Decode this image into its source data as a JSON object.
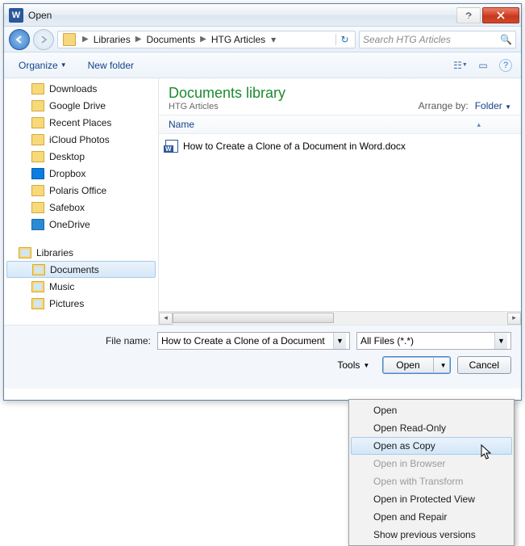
{
  "window": {
    "title": "Open"
  },
  "breadcrumb": {
    "items": [
      "Libraries",
      "Documents",
      "HTG Articles"
    ]
  },
  "search": {
    "placeholder": "Search HTG Articles"
  },
  "toolbar": {
    "organize": "Organize",
    "newfolder": "New folder"
  },
  "tree": {
    "items": [
      "Downloads",
      "Google Drive",
      "Recent Places",
      "iCloud Photos",
      "Desktop",
      "Dropbox",
      "Polaris Office",
      "Safebox",
      "OneDrive"
    ],
    "libs_label": "Libraries",
    "libs": [
      "Documents",
      "Music",
      "Pictures"
    ]
  },
  "library": {
    "title": "Documents library",
    "subtitle": "HTG Articles",
    "arrange_label": "Arrange by:",
    "arrange_value": "Folder"
  },
  "columns": {
    "name": "Name"
  },
  "files": [
    {
      "name": "How to Create a Clone of a Document in Word.docx"
    }
  ],
  "footer": {
    "filename_label": "File name:",
    "filename_value": "How to Create a Clone of a Document",
    "filter_value": "All Files (*.*)",
    "tools_label": "Tools",
    "open_label": "Open",
    "cancel_label": "Cancel"
  },
  "menu": {
    "items": [
      "Open",
      "Open Read-Only",
      "Open as Copy",
      "Open in Browser",
      "Open with Transform",
      "Open in Protected View",
      "Open and Repair",
      "Show previous versions"
    ],
    "hover_index": 2,
    "disabled": [
      3,
      4
    ]
  }
}
